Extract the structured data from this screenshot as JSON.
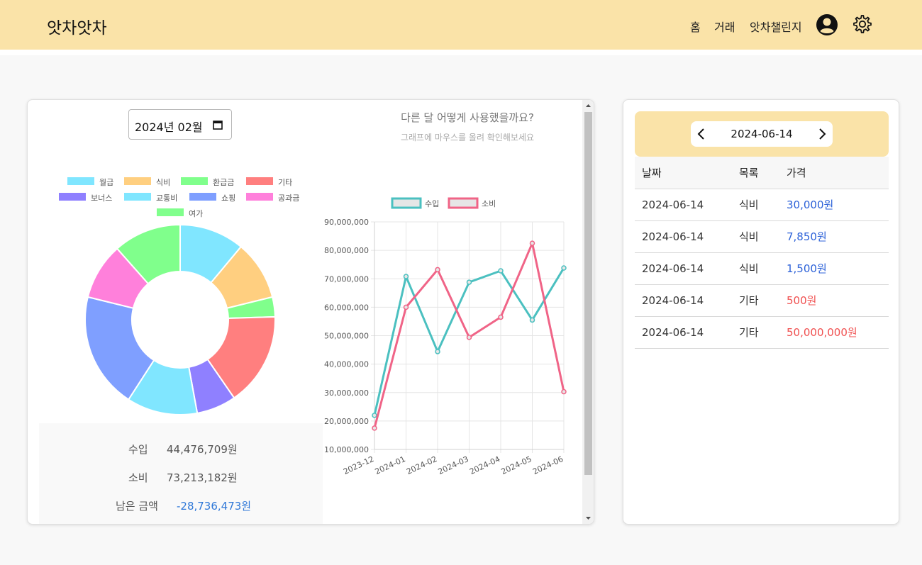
{
  "app": {
    "brand": "앗차앗차",
    "nav": {
      "home": "홈",
      "transactions": "거래",
      "challenge": "앗차챌린지"
    },
    "icons": {
      "profile": "user-circle-icon",
      "settings": "gear-icon",
      "calendar": "calendar-icon"
    }
  },
  "month_picker": {
    "value": "2024년 02월"
  },
  "graph": {
    "title": "다른 달 어떻게 사용했을까요?",
    "subtitle": "그래프에 마우스를 올려 확인해보세요"
  },
  "summary": {
    "income_label": "수입",
    "income_value": "44,476,709원",
    "expense_label": "소비",
    "expense_value": "73,213,182원",
    "remain_label": "남은 금액",
    "remain_value": "-28,736,473원"
  },
  "chart_data": [
    {
      "type": "pie",
      "categories": [
        "월급",
        "식비",
        "환급금",
        "기타",
        "보너스",
        "교통비",
        "쇼핑",
        "공과금",
        "여가"
      ],
      "values": [
        11.5,
        10.5,
        3.5,
        16.5,
        7,
        12.5,
        20.5,
        10,
        12
      ],
      "colors": [
        "#80e6ff",
        "#ffcf80",
        "#80ff8c",
        "#ff7f7f",
        "#8f80ff",
        "#80e6ff",
        "#7f9fff",
        "#ff80db",
        "#80ff8c"
      ],
      "legend": "top"
    },
    {
      "type": "line",
      "x": [
        "2023-12",
        "2024-01",
        "2024-02",
        "2024-03",
        "2024-04",
        "2024-05",
        "2024-06"
      ],
      "series": [
        {
          "name": "수입",
          "color": "#4bc0c0",
          "values": [
            22000000,
            70800000,
            44400000,
            68800000,
            72800000,
            55500000,
            73800000
          ]
        },
        {
          "name": "소비",
          "color": "#f06487",
          "values": [
            17500000,
            60000000,
            73200000,
            49400000,
            56500000,
            82500000,
            30300000
          ]
        }
      ],
      "yticks": [
        "10,000,000",
        "20,000,000",
        "30,000,000",
        "40,000,000",
        "50,000,000",
        "60,000,000",
        "70,000,000",
        "80,000,000",
        "90,000,000"
      ],
      "ylim": [
        10000000,
        90000000
      ],
      "grid": true,
      "legend": "top"
    }
  ],
  "date_nav": {
    "date": "2024-06-14"
  },
  "table": {
    "headers": [
      "날짜",
      "목록",
      "가격"
    ],
    "rows": [
      {
        "date": "2024-06-14",
        "category": "식비",
        "price": "30,000원",
        "kind": "plus"
      },
      {
        "date": "2024-06-14",
        "category": "식비",
        "price": "7,850원",
        "kind": "plus"
      },
      {
        "date": "2024-06-14",
        "category": "식비",
        "price": "1,500원",
        "kind": "plus"
      },
      {
        "date": "2024-06-14",
        "category": "기타",
        "price": "500원",
        "kind": "minus"
      },
      {
        "date": "2024-06-14",
        "category": "기타",
        "price": "50,000,000원",
        "kind": "minus"
      }
    ]
  }
}
